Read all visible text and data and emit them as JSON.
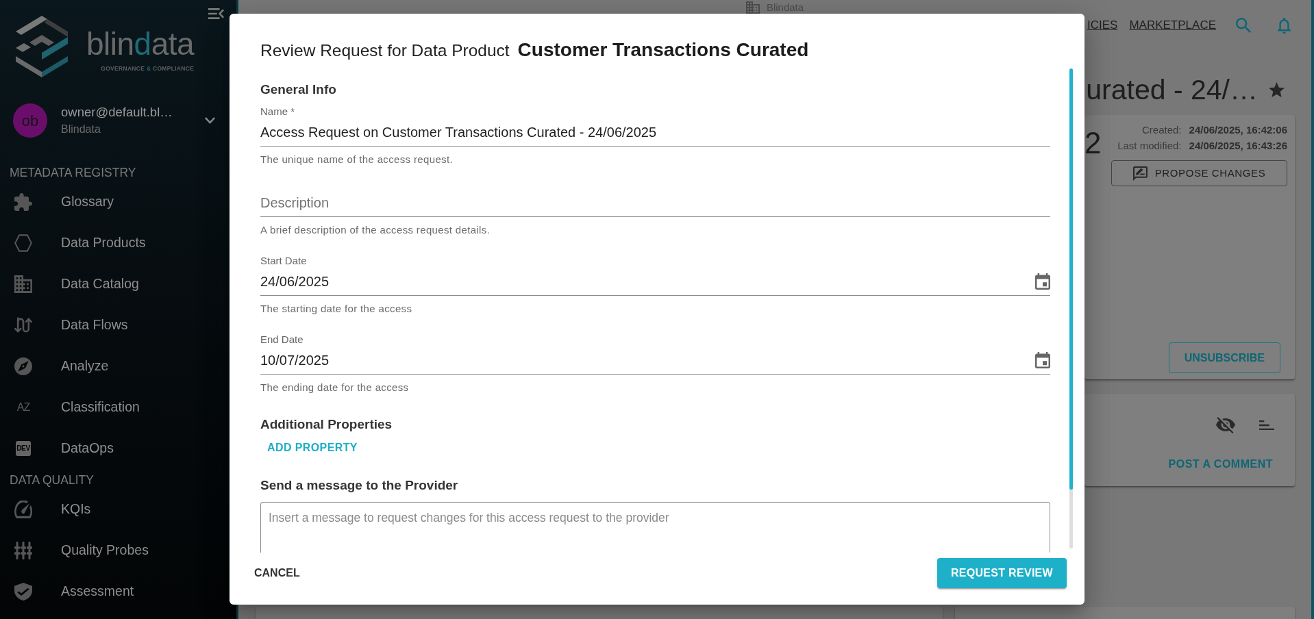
{
  "sidebar": {
    "logo": {
      "wordmark": [
        {
          "text": "blin",
          "accent": false
        },
        {
          "text": "d",
          "accent": true
        },
        {
          "text": "ata",
          "accent": false
        }
      ],
      "tagline": [
        {
          "text": "GOVERNANCE ",
          "accent": false
        },
        {
          "text": "&",
          "accent": true
        },
        {
          "text": " COMPLIANCE",
          "accent": false
        }
      ]
    },
    "user": {
      "initials": "ob",
      "email": "owner@default.bl…",
      "organization": "Blindata"
    },
    "sections": [
      {
        "title": "METADATA REGISTRY",
        "items": [
          {
            "label": "Glossary"
          },
          {
            "label": "Data Products"
          },
          {
            "label": "Data Catalog"
          },
          {
            "label": "Data Flows"
          },
          {
            "label": "Analyze"
          },
          {
            "label": "Classification",
            "icon_text": "AZ"
          },
          {
            "label": "DataOps",
            "icon_text": "DEV"
          }
        ]
      },
      {
        "title": "DATA QUALITY",
        "items": [
          {
            "label": "KQIs"
          },
          {
            "label": "Quality Probes"
          },
          {
            "label": "Assessment"
          }
        ]
      }
    ]
  },
  "background_page": {
    "breadcrumb": "Blindata",
    "nav_links": [
      "ICIES",
      "MARKETPLACE"
    ],
    "title": "urated - 24/…",
    "summary_card": {
      "count": "2",
      "meta": [
        {
          "label": "Created:",
          "value": "24/06/2025, 16:42:06"
        },
        {
          "label": "Last modified:",
          "value": "24/06/2025, 16:43:26"
        }
      ],
      "propose_button": "PROPOSE CHANGES",
      "unsubscribe_button": "UNSUBSCRIBE"
    },
    "comments_card": {
      "post_button": "POST A COMMENT"
    }
  },
  "dialog": {
    "title": "Review Request for Data Product",
    "product_name": "Customer Transactions Curated",
    "general_info": {
      "title": "General Info",
      "fields": [
        {
          "kind": "text",
          "label": "Name *",
          "value": "Access Request on Customer Transactions Curated - 24/06/2025",
          "helper": "The unique name of the access request."
        },
        {
          "kind": "text",
          "placeholder": "Description",
          "helper": "A brief description of the access request details."
        },
        {
          "kind": "date",
          "label": "Start Date",
          "value": "24/06/2025",
          "helper": "The starting date for the access"
        },
        {
          "kind": "date",
          "label": "End Date",
          "value": "10/07/2025",
          "helper": "The ending date for the access"
        }
      ]
    },
    "additional_properties": {
      "title": "Additional Properties",
      "add_button": "ADD PROPERTY"
    },
    "message": {
      "title": "Send a message to the Provider",
      "placeholder": "Insert a message to request changes for this access request to the provider"
    },
    "actions": [
      {
        "kind": "text",
        "label": "CANCEL"
      },
      {
        "kind": "contained",
        "label": "REQUEST REVIEW"
      }
    ]
  }
}
